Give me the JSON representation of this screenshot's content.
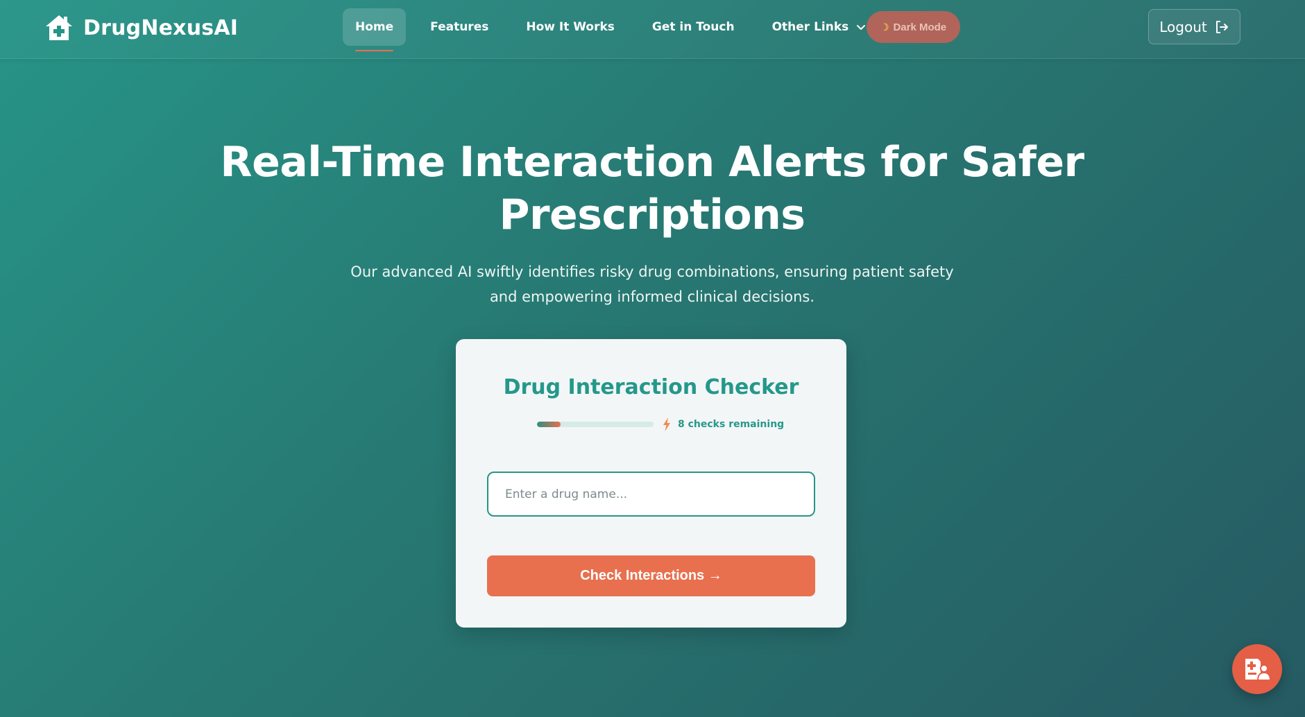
{
  "brand": {
    "name": "DrugNexusAI",
    "icon": "house-medical-icon"
  },
  "nav": {
    "items": [
      {
        "label": "Home",
        "active": true
      },
      {
        "label": "Features"
      },
      {
        "label": "How It Works"
      },
      {
        "label": "Get in Touch"
      },
      {
        "label": "Other Links",
        "has_dropdown": true
      }
    ],
    "dark_mode_label": "Dark Mode",
    "dark_mode_icon": "moon-icon",
    "logout_label": "Logout",
    "logout_icon": "logout-icon"
  },
  "hero": {
    "title": "Real-Time Interaction Alerts for Safer Prescriptions",
    "subtitle": "Our advanced AI swiftly identifies risky drug combinations, ensuring patient safety and empowering informed clinical decisions."
  },
  "checker": {
    "title": "Drug Interaction Checker",
    "checks_remaining_text": "8 checks remaining",
    "usage_fraction": 0.2,
    "input_placeholder": "Enter a drug name...",
    "input_value": "",
    "button_label": "Check Interactions →"
  },
  "fab": {
    "icon": "medical-record-icon"
  },
  "colors": {
    "teal": "#279488",
    "coral": "#e8704f",
    "card_bg": "#f3f6f7",
    "dark_toggle": "#b0645a"
  }
}
